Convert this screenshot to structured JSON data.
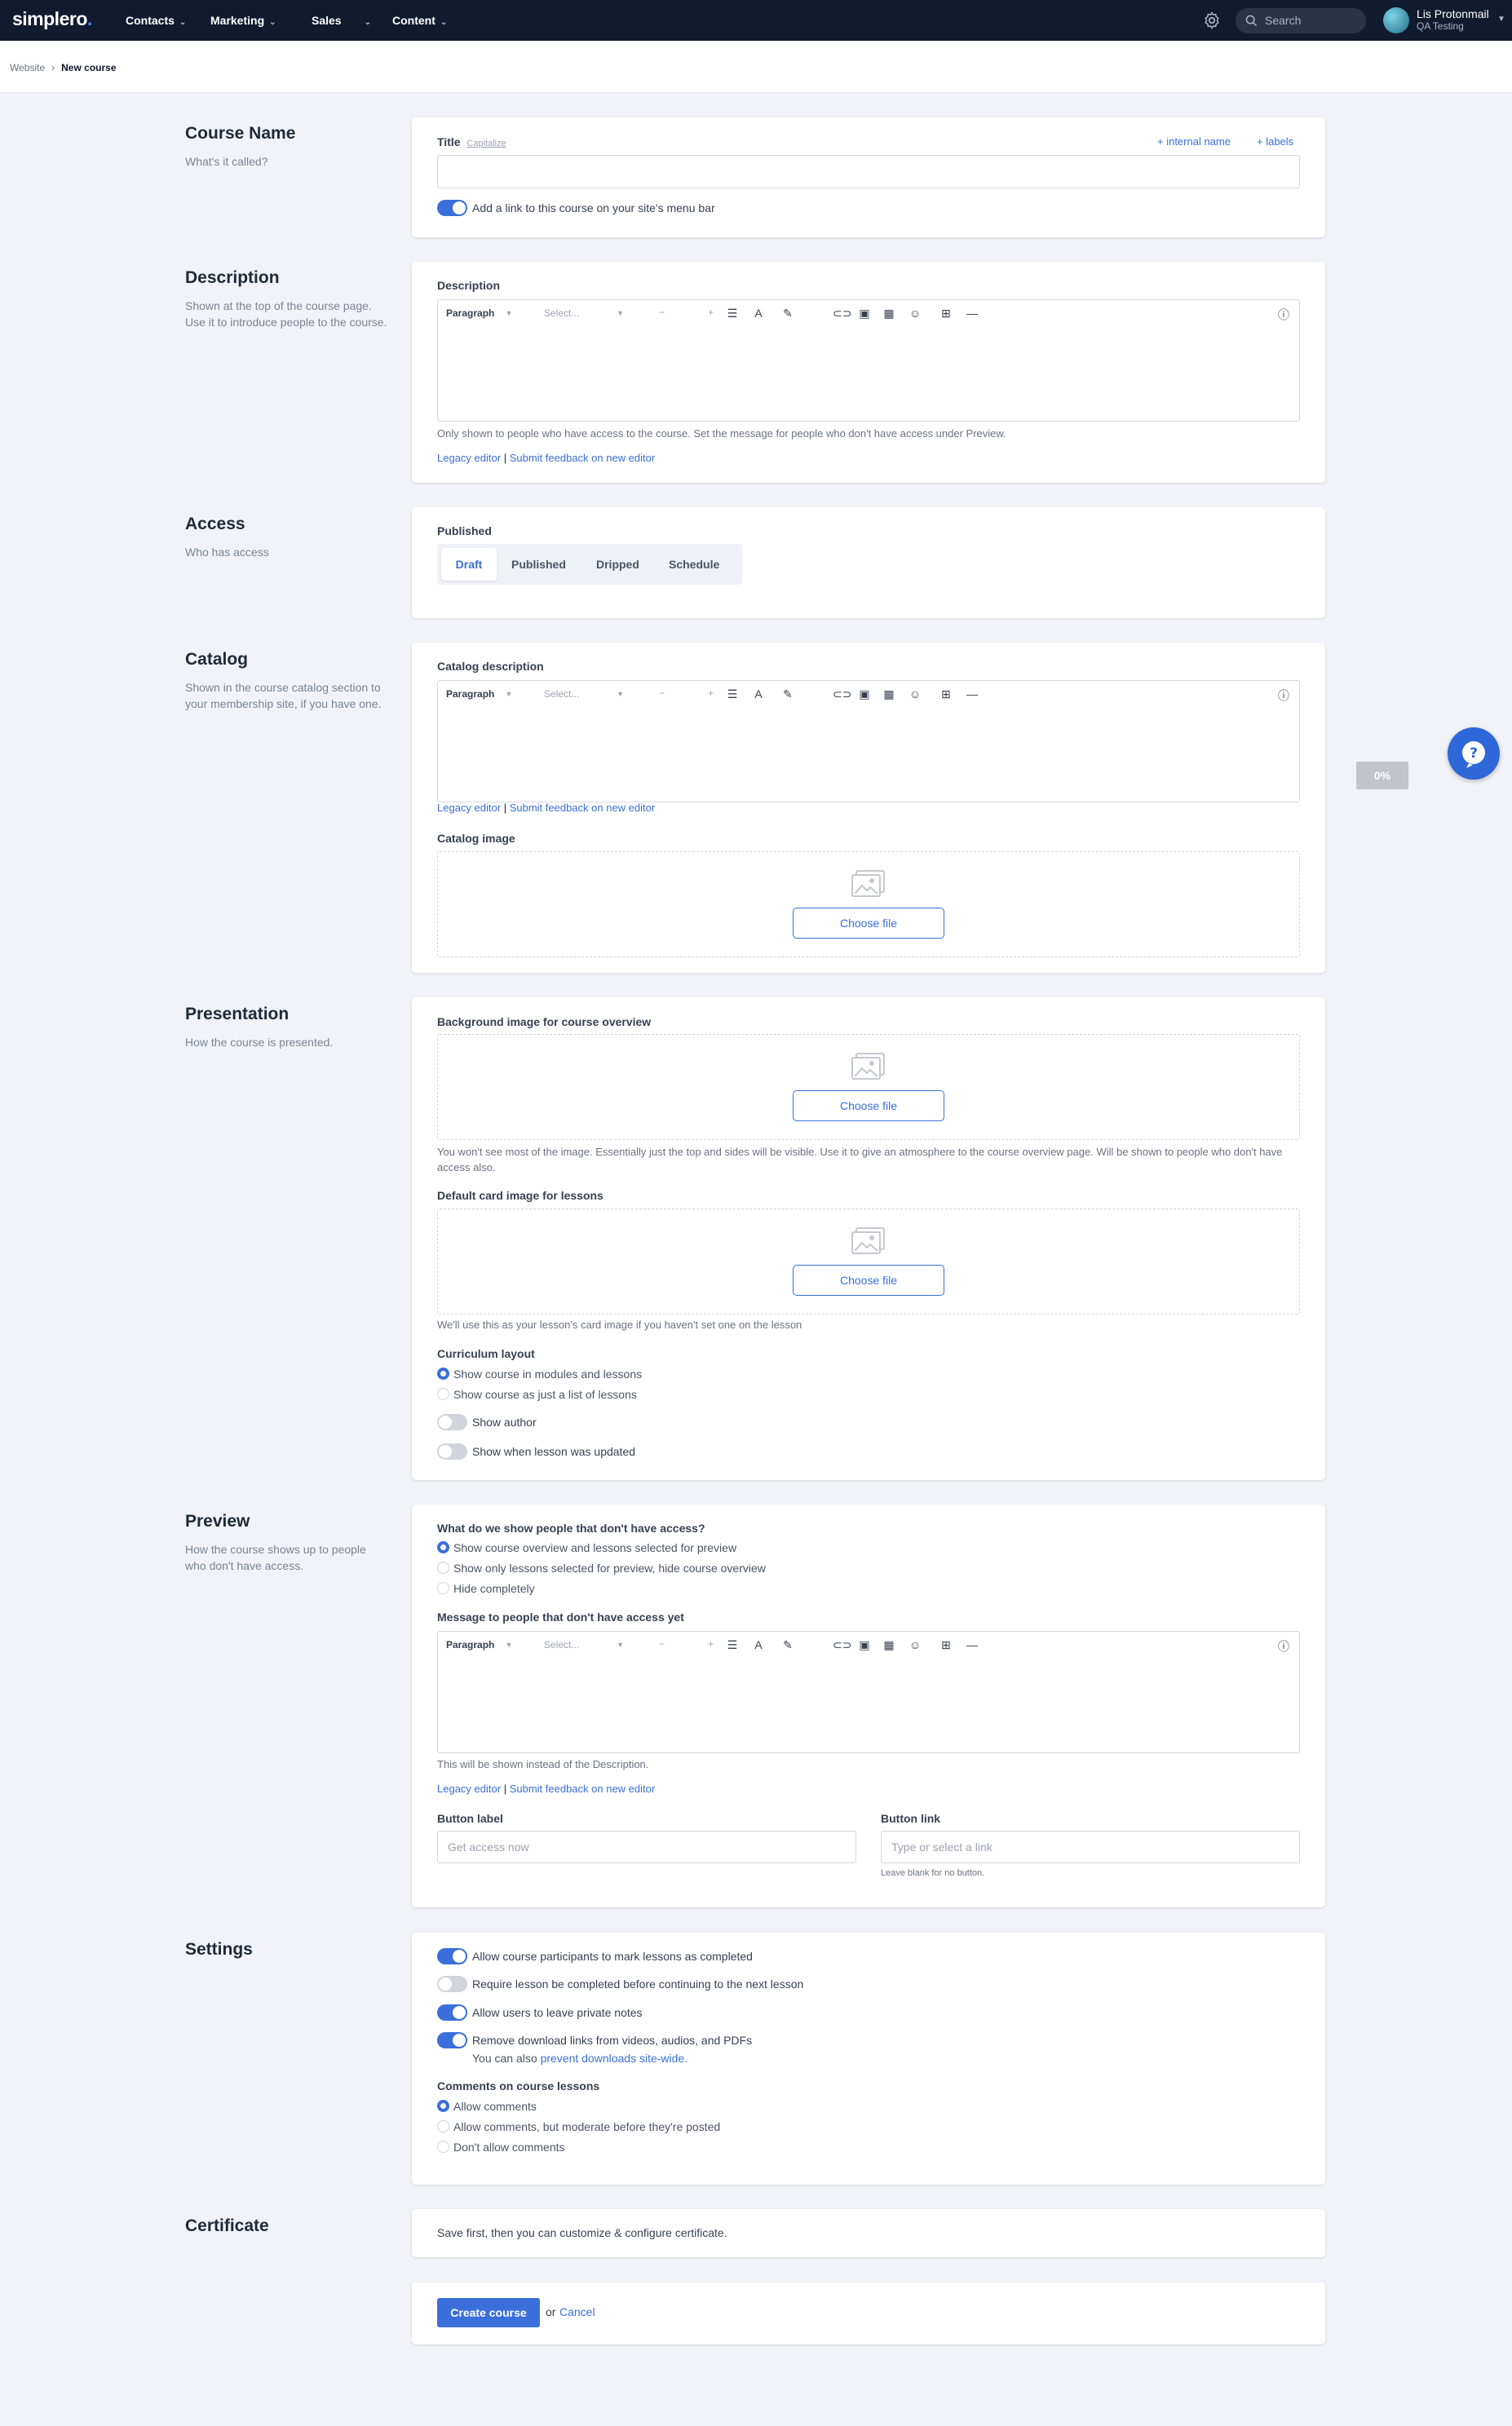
{
  "topbar": {
    "logo": "simplero",
    "logo_dot": ".",
    "nav": [
      {
        "label": "Contacts"
      },
      {
        "label": "Marketing"
      },
      {
        "label": "Sales"
      },
      {
        "label": "Content"
      }
    ],
    "search_placeholder": "Search",
    "user_name": "Lis Protonmail",
    "user_account": "QA Testing"
  },
  "breadcrumb": {
    "parent": "Website",
    "current": "New course"
  },
  "sections": {
    "course_name": {
      "title": "Course Name",
      "desc": "What's it called?"
    },
    "description": {
      "title": "Description",
      "desc": "Shown at the top of the course page. Use it to introduce people to the course."
    },
    "access": {
      "title": "Access",
      "desc": "Who has access"
    },
    "catalog": {
      "title": "Catalog",
      "desc": "Shown in the course catalog section to your membership site, if you have one."
    },
    "presentation": {
      "title": "Presentation",
      "desc": "How the course is presented."
    },
    "preview": {
      "title": "Preview",
      "desc": "How the course shows up to people who don't have access."
    },
    "settings": {
      "title": "Settings"
    },
    "certificate": {
      "title": "Certificate"
    }
  },
  "course_name_card": {
    "title_label": "Title",
    "capitalize": "Capitalize",
    "internal_name": "+ internal name",
    "labels": "+ labels",
    "menu_toggle_label": "Add a link to this course on your site's menu bar",
    "menu_toggle_on": true
  },
  "editor_toolbar": {
    "paragraph": "Paragraph",
    "select": "Select...",
    "minus": "−",
    "plus": "+"
  },
  "description_card": {
    "label": "Description",
    "help": "Only shown to people who have access to the course. Set the message for people who don't have access under Preview.",
    "legacy": "Legacy editor",
    "sep": "|",
    "feedback": "Submit feedback on new editor"
  },
  "access_card": {
    "label": "Published",
    "tabs": [
      "Draft",
      "Published",
      "Dripped",
      "Schedule"
    ],
    "active_tab": "Draft"
  },
  "catalog_card": {
    "desc_label": "Catalog description",
    "legacy": "Legacy editor",
    "sep": "|",
    "feedback": "Submit feedback on new editor",
    "image_label": "Catalog image",
    "choose": "Choose file"
  },
  "presentation_card": {
    "bg_label": "Background image for course overview",
    "choose": "Choose file",
    "bg_help": "You won't see most of the image. Essentially just the top and sides will be visible. Use it to give an atmosphere to the course overview page. Will be shown to people who don't have access also.",
    "card_label": "Default card image for lessons",
    "card_help": "We'll use this as your lesson's card image if you haven't set one on the lesson",
    "layout_label": "Curriculum layout",
    "layout_options": [
      "Show course in modules and lessons",
      "Show course as just a list of lessons"
    ],
    "layout_selected": 0,
    "show_author": "Show author",
    "show_author_on": false,
    "show_updated": "Show when lesson was updated",
    "show_updated_on": false
  },
  "preview_card": {
    "question": "What do we show people that don't have access?",
    "options": [
      "Show course overview and lessons selected for preview",
      "Show only lessons selected for preview, hide course overview",
      "Hide completely"
    ],
    "selected": 0,
    "message_label": "Message to people that don't have access yet",
    "message_help": "This will be shown instead of the Description.",
    "legacy": "Legacy editor",
    "sep": "|",
    "feedback": "Submit feedback on new editor",
    "button_label": "Button label",
    "button_label_placeholder": "Get access now",
    "button_link": "Button link",
    "button_link_placeholder": "Type or select a link",
    "button_link_help": "Leave blank for no button."
  },
  "settings_card": {
    "toggles": [
      {
        "label": "Allow course participants to mark lessons as completed",
        "on": true
      },
      {
        "label": "Require lesson be completed before continuing to the next lesson",
        "on": false
      },
      {
        "label": "Allow users to leave private notes",
        "on": true
      },
      {
        "label": "Remove download links from videos, audios, and PDFs",
        "on": true
      }
    ],
    "downloads_note": "You can also",
    "downloads_link": "prevent downloads site-wide.",
    "comments_label": "Comments on course lessons",
    "comment_options": [
      "Allow comments",
      "Allow comments, but moderate before they're posted",
      "Don't allow comments"
    ],
    "comment_selected": 0
  },
  "certificate_card": {
    "text": "Save first, then you can customize & configure certificate."
  },
  "footer": {
    "create": "Create course",
    "or": "or",
    "cancel": "Cancel"
  },
  "progress_badge": "0%",
  "colors": {
    "accent": "#3a6fdb",
    "topbar": "#111a2e",
    "page_bg": "#f1f3f8"
  }
}
